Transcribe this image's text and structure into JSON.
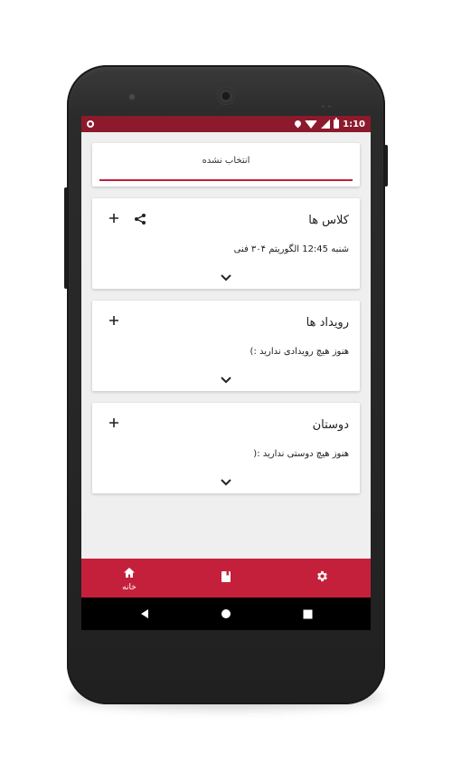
{
  "status_bar": {
    "time": "1:10",
    "icons": [
      "notification-dot-icon",
      "location-icon",
      "wifi-icon",
      "cell-signal-icon",
      "battery-icon"
    ]
  },
  "selector": {
    "label": "انتخاب نشده"
  },
  "cards": [
    {
      "title": "کلاس ها",
      "body": "شنبه 12:45 الگوریتم ۳۰۴ فنی",
      "actions": [
        "add-icon",
        "share-icon"
      ]
    },
    {
      "title": "رویداد ها",
      "body": "هنوز هیچ رویدادی ندارید :)",
      "actions": [
        "add-icon"
      ]
    },
    {
      "title": "دوستان",
      "body": "هنوز هیچ دوستی ندارید :(",
      "actions": [
        "add-icon"
      ]
    }
  ],
  "bottom_nav": {
    "items": [
      {
        "icon": "home-icon",
        "label": "خانه"
      },
      {
        "icon": "book-icon",
        "label": ""
      },
      {
        "icon": "gear-icon",
        "label": ""
      }
    ]
  },
  "colors": {
    "accent": "#c4203c",
    "status_bar": "#8c1a2c",
    "background": "#efefef"
  }
}
